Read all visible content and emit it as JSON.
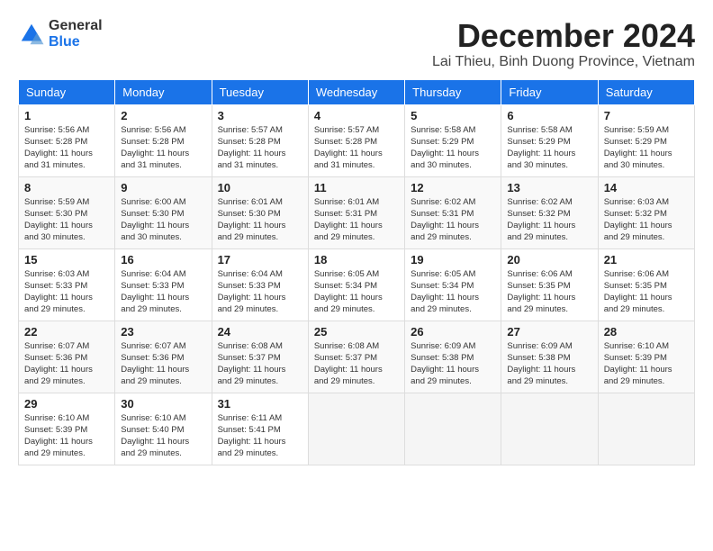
{
  "logo": {
    "general": "General",
    "blue": "Blue"
  },
  "header": {
    "month": "December 2024",
    "location": "Lai Thieu, Binh Duong Province, Vietnam"
  },
  "weekdays": [
    "Sunday",
    "Monday",
    "Tuesday",
    "Wednesday",
    "Thursday",
    "Friday",
    "Saturday"
  ],
  "weeks": [
    [
      {
        "day": "1",
        "sunrise": "5:56 AM",
        "sunset": "5:28 PM",
        "daylight": "11 hours and 31 minutes."
      },
      {
        "day": "2",
        "sunrise": "5:56 AM",
        "sunset": "5:28 PM",
        "daylight": "11 hours and 31 minutes."
      },
      {
        "day": "3",
        "sunrise": "5:57 AM",
        "sunset": "5:28 PM",
        "daylight": "11 hours and 31 minutes."
      },
      {
        "day": "4",
        "sunrise": "5:57 AM",
        "sunset": "5:28 PM",
        "daylight": "11 hours and 31 minutes."
      },
      {
        "day": "5",
        "sunrise": "5:58 AM",
        "sunset": "5:29 PM",
        "daylight": "11 hours and 30 minutes."
      },
      {
        "day": "6",
        "sunrise": "5:58 AM",
        "sunset": "5:29 PM",
        "daylight": "11 hours and 30 minutes."
      },
      {
        "day": "7",
        "sunrise": "5:59 AM",
        "sunset": "5:29 PM",
        "daylight": "11 hours and 30 minutes."
      }
    ],
    [
      {
        "day": "8",
        "sunrise": "5:59 AM",
        "sunset": "5:30 PM",
        "daylight": "11 hours and 30 minutes."
      },
      {
        "day": "9",
        "sunrise": "6:00 AM",
        "sunset": "5:30 PM",
        "daylight": "11 hours and 30 minutes."
      },
      {
        "day": "10",
        "sunrise": "6:01 AM",
        "sunset": "5:30 PM",
        "daylight": "11 hours and 29 minutes."
      },
      {
        "day": "11",
        "sunrise": "6:01 AM",
        "sunset": "5:31 PM",
        "daylight": "11 hours and 29 minutes."
      },
      {
        "day": "12",
        "sunrise": "6:02 AM",
        "sunset": "5:31 PM",
        "daylight": "11 hours and 29 minutes."
      },
      {
        "day": "13",
        "sunrise": "6:02 AM",
        "sunset": "5:32 PM",
        "daylight": "11 hours and 29 minutes."
      },
      {
        "day": "14",
        "sunrise": "6:03 AM",
        "sunset": "5:32 PM",
        "daylight": "11 hours and 29 minutes."
      }
    ],
    [
      {
        "day": "15",
        "sunrise": "6:03 AM",
        "sunset": "5:33 PM",
        "daylight": "11 hours and 29 minutes."
      },
      {
        "day": "16",
        "sunrise": "6:04 AM",
        "sunset": "5:33 PM",
        "daylight": "11 hours and 29 minutes."
      },
      {
        "day": "17",
        "sunrise": "6:04 AM",
        "sunset": "5:33 PM",
        "daylight": "11 hours and 29 minutes."
      },
      {
        "day": "18",
        "sunrise": "6:05 AM",
        "sunset": "5:34 PM",
        "daylight": "11 hours and 29 minutes."
      },
      {
        "day": "19",
        "sunrise": "6:05 AM",
        "sunset": "5:34 PM",
        "daylight": "11 hours and 29 minutes."
      },
      {
        "day": "20",
        "sunrise": "6:06 AM",
        "sunset": "5:35 PM",
        "daylight": "11 hours and 29 minutes."
      },
      {
        "day": "21",
        "sunrise": "6:06 AM",
        "sunset": "5:35 PM",
        "daylight": "11 hours and 29 minutes."
      }
    ],
    [
      {
        "day": "22",
        "sunrise": "6:07 AM",
        "sunset": "5:36 PM",
        "daylight": "11 hours and 29 minutes."
      },
      {
        "day": "23",
        "sunrise": "6:07 AM",
        "sunset": "5:36 PM",
        "daylight": "11 hours and 29 minutes."
      },
      {
        "day": "24",
        "sunrise": "6:08 AM",
        "sunset": "5:37 PM",
        "daylight": "11 hours and 29 minutes."
      },
      {
        "day": "25",
        "sunrise": "6:08 AM",
        "sunset": "5:37 PM",
        "daylight": "11 hours and 29 minutes."
      },
      {
        "day": "26",
        "sunrise": "6:09 AM",
        "sunset": "5:38 PM",
        "daylight": "11 hours and 29 minutes."
      },
      {
        "day": "27",
        "sunrise": "6:09 AM",
        "sunset": "5:38 PM",
        "daylight": "11 hours and 29 minutes."
      },
      {
        "day": "28",
        "sunrise": "6:10 AM",
        "sunset": "5:39 PM",
        "daylight": "11 hours and 29 minutes."
      }
    ],
    [
      {
        "day": "29",
        "sunrise": "6:10 AM",
        "sunset": "5:39 PM",
        "daylight": "11 hours and 29 minutes."
      },
      {
        "day": "30",
        "sunrise": "6:10 AM",
        "sunset": "5:40 PM",
        "daylight": "11 hours and 29 minutes."
      },
      {
        "day": "31",
        "sunrise": "6:11 AM",
        "sunset": "5:41 PM",
        "daylight": "11 hours and 29 minutes."
      },
      null,
      null,
      null,
      null
    ]
  ]
}
